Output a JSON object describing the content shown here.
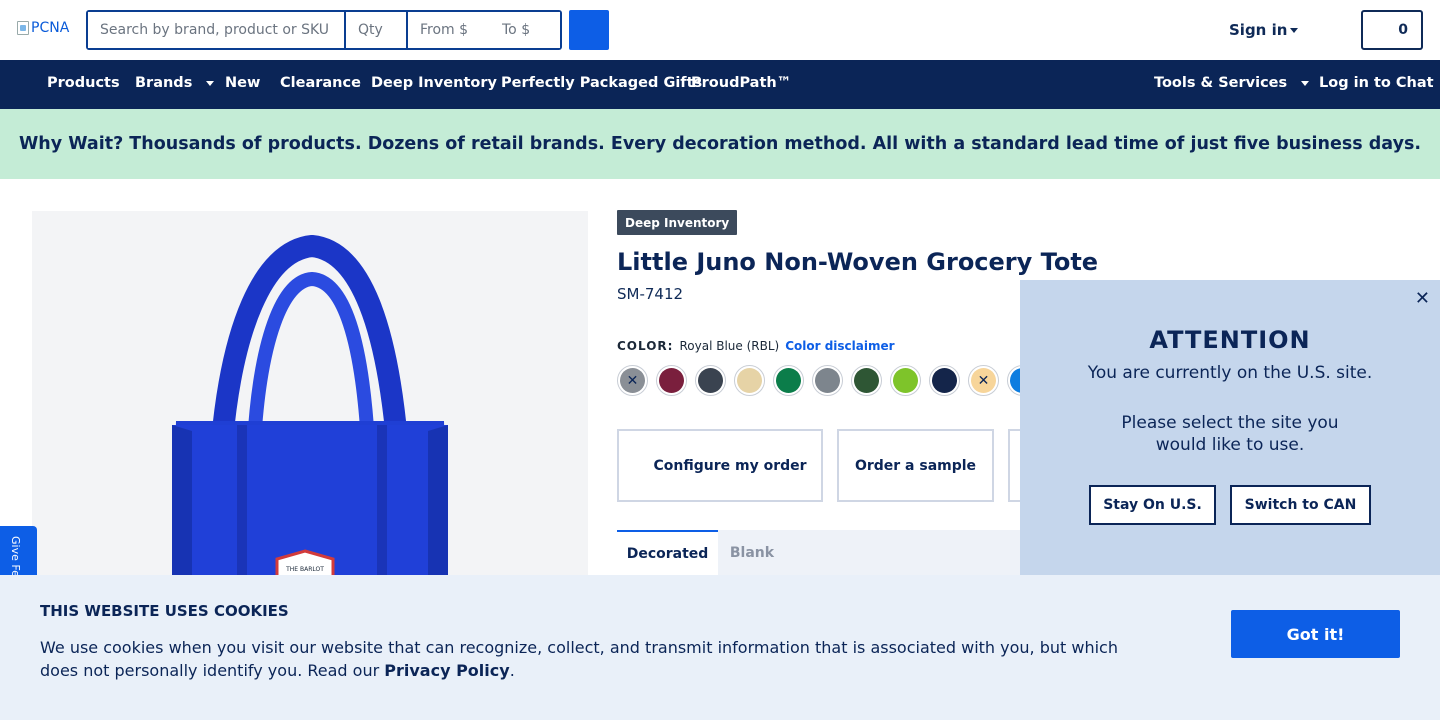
{
  "header": {
    "logo_alt": "PCNA",
    "search_placeholder": "Search by brand, product or SKU",
    "qty_placeholder": "Qty",
    "from_placeholder": "From $",
    "to_placeholder": "To $",
    "signin_label": "Sign in",
    "cart_count": "0"
  },
  "nav": {
    "items": [
      "Products",
      "Brands",
      "New",
      "Clearance",
      "Deep Inventory",
      "Perfectly Packaged Gifts",
      "ProudPath™"
    ],
    "tools_label": "Tools & Services",
    "chat_label": "Log in to Chat"
  },
  "promo": {
    "text": "Why Wait? Thousands of products. Dozens of retail brands. Every decoration method. All with a standard lead time of just five business days."
  },
  "product": {
    "badge": "Deep Inventory",
    "title": "Little Juno Non-Woven Grocery Tote",
    "sku": "SM-7412",
    "color_label": "COLOR:",
    "color_value": "Royal Blue (RBL)",
    "color_disclaimer": "Color disclaimer",
    "swatches": [
      {
        "color": "#8a8f96",
        "unavailable": true
      },
      {
        "color": "#7a1f3d",
        "unavailable": false
      },
      {
        "color": "#3a4350",
        "unavailable": false
      },
      {
        "color": "#e6d3a6",
        "unavailable": false
      },
      {
        "color": "#0b7d4a",
        "unavailable": false
      },
      {
        "color": "#7d858d",
        "unavailable": false
      },
      {
        "color": "#2e5634",
        "unavailable": false
      },
      {
        "color": "#7ec42a",
        "unavailable": false
      },
      {
        "color": "#14254a",
        "unavailable": false
      },
      {
        "color": "#f7d59a",
        "unavailable": true
      },
      {
        "color": "#0d7de0",
        "unavailable": false
      }
    ],
    "configure_label": "Configure my order",
    "sample_label": "Order a sample",
    "tabs": [
      "Decorated",
      "Blank"
    ],
    "image_print": "THE BARLOT"
  },
  "feedback_label": "Give Feedback",
  "attention": {
    "title": "ATTENTION",
    "line1": "You are currently on the U.S. site.",
    "line2": "Please select the site you would like to use.",
    "stay_label": "Stay On U.S.",
    "switch_label": "Switch to CAN"
  },
  "cookie": {
    "title": "THIS WEBSITE USES COOKIES",
    "text": "We use cookies when you visit our website that can recognize, collect, and transmit information that is associated with you, but which does not personally identify you. Read our ",
    "policy_link": "Privacy Policy",
    "text_end": ".",
    "button_label": "Got it!"
  },
  "colors": {
    "navy": "#0b2557",
    "accent": "#0d5ee6",
    "promo_bg": "#c4ecd6",
    "modal_bg": "#c5d6ec",
    "bag_blue": "#1f3fd4"
  }
}
